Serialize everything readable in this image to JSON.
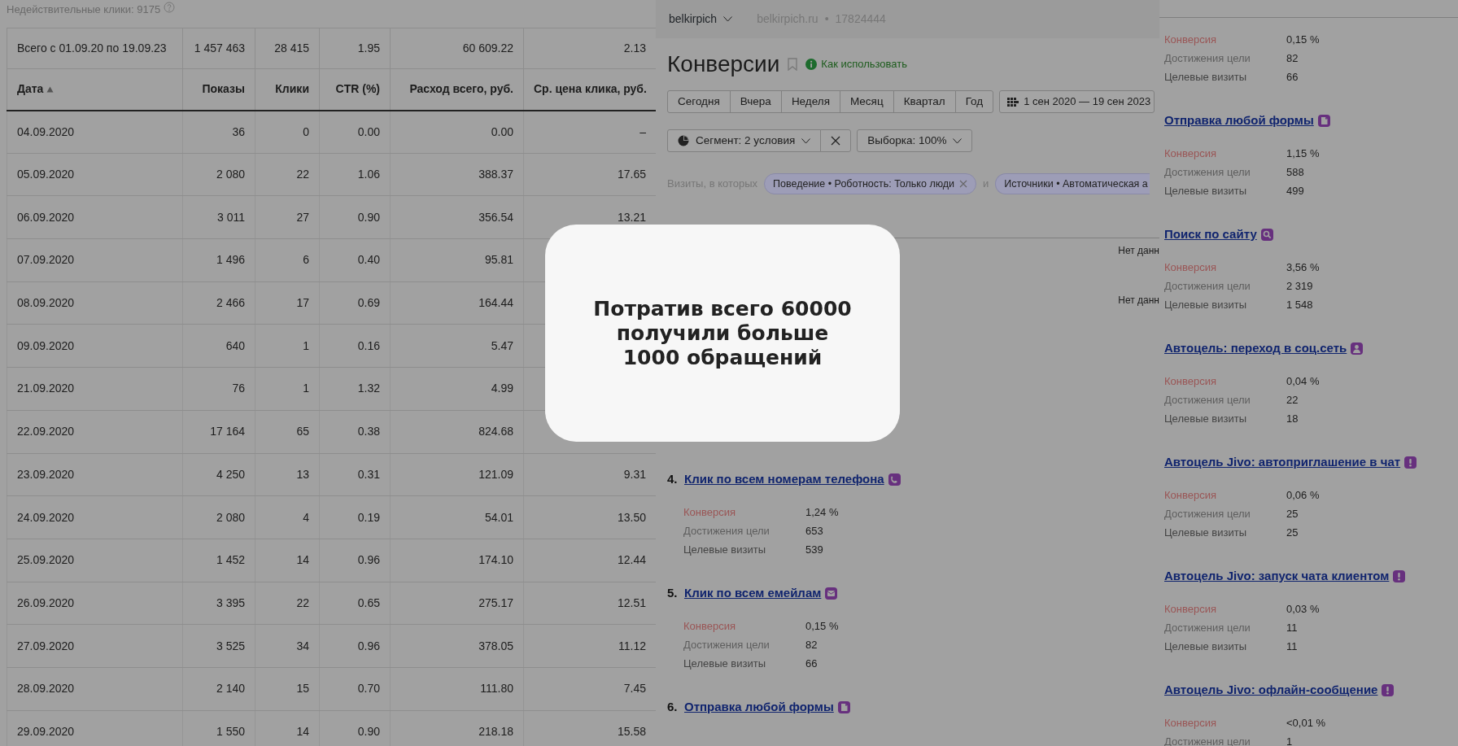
{
  "left_panel": {
    "invalid_clicks": "Недействительные клики: 9175",
    "table": {
      "total_row": [
        "Всего с 01.09.20 по 19.09.23",
        "1 457 463",
        "28 415",
        "1.95",
        "60 609.22",
        "2.13"
      ],
      "columns": [
        {
          "label": "Дата",
          "sorted": true
        },
        {
          "label": "Показы",
          "sorted": false
        },
        {
          "label": "Клики",
          "sorted": false
        },
        {
          "label": "CTR (%)",
          "sorted": false
        },
        {
          "label": "Расход всего, руб.",
          "sorted": false
        },
        {
          "label": "Ср. цена клика, руб.",
          "sorted": false
        }
      ],
      "rows": [
        [
          "04.09.2020",
          "36",
          "0",
          "0.00",
          "0.00",
          "–"
        ],
        [
          "05.09.2020",
          "2 080",
          "22",
          "1.06",
          "388.37",
          "17.65"
        ],
        [
          "06.09.2020",
          "3 011",
          "27",
          "0.90",
          "356.54",
          "13.21"
        ],
        [
          "07.09.2020",
          "1 496",
          "6",
          "0.40",
          "95.81"
        ],
        [
          "08.09.2020",
          "2 466",
          "17",
          "0.69",
          "164.44"
        ],
        [
          "09.09.2020",
          "640",
          "1",
          "0.16",
          "5.47"
        ],
        [
          "21.09.2020",
          "76",
          "1",
          "1.32",
          "4.99"
        ],
        [
          "22.09.2020",
          "17 164",
          "65",
          "0.38",
          "824.68"
        ],
        [
          "23.09.2020",
          "4 250",
          "13",
          "0.31",
          "121.09",
          "9.31"
        ],
        [
          "24.09.2020",
          "2 080",
          "4",
          "0.19",
          "54.01",
          "13.50"
        ],
        [
          "25.09.2020",
          "1 452",
          "14",
          "0.96",
          "174.10",
          "12.44"
        ],
        [
          "26.09.2020",
          "3 395",
          "22",
          "0.65",
          "275.17",
          "12.51"
        ],
        [
          "27.09.2020",
          "3 525",
          "34",
          "0.96",
          "378.05",
          "11.12"
        ],
        [
          "28.09.2020",
          "2 140",
          "15",
          "0.70",
          "111.80",
          "7.45"
        ],
        [
          "29.09.2020",
          "1 550",
          "14",
          "0.90",
          "218.18",
          "15.58"
        ]
      ]
    }
  },
  "middle_panel": {
    "counter": "belkirpich",
    "site": "belkirpich.ru",
    "separator": "•",
    "counter_id": "17824444",
    "title": "Конверсии",
    "help_link": "Как использовать",
    "periods": [
      "Сегодня",
      "Вчера",
      "Неделя",
      "Месяц",
      "Квартал",
      "Год"
    ],
    "date_range": "1 сен 2020 — 19 сен 2023",
    "segment": "Сегмент: 2 условия",
    "sample": "Выборка: 100%",
    "filter_label": "Визиты, в которых",
    "filter_joiner": "и",
    "chips": [
      {
        "label": "Поведение • Роботность: Только люди",
        "removable": true
      },
      {
        "label": "Источники • Автоматическая а",
        "removable": false
      }
    ],
    "partial_rows": [
      {
        "status": "Нет данн"
      },
      {
        "status": "Нет данн"
      }
    ],
    "goals": [
      {
        "number": "4.",
        "title": "Клик по всем номерам телефона",
        "kind": "phone",
        "metrics": [
          {
            "kind": "conversion",
            "label": "Конверсия",
            "value": "1,24 %"
          },
          {
            "kind": "reached",
            "label": "Достижения цели",
            "value": "653"
          },
          {
            "kind": "visits",
            "label": "Целевые визиты",
            "value": "539"
          }
        ]
      },
      {
        "number": "5.",
        "title": "Клик по всем емейлам",
        "kind": "email",
        "metrics": [
          {
            "kind": "conversion",
            "label": "Конверсия",
            "value": "0,15 %"
          },
          {
            "kind": "reached",
            "label": "Достижения цели",
            "value": "82"
          },
          {
            "kind": "visits",
            "label": "Целевые визиты",
            "value": "66"
          }
        ]
      },
      {
        "number": "6.",
        "title": "Отправка любой формы",
        "kind": "form"
      }
    ]
  },
  "right_panel": {
    "goals": [
      {
        "metrics": [
          {
            "kind": "conversion",
            "label": "Конверсия",
            "value": "0,15 %"
          },
          {
            "kind": "reached",
            "label": "Достижения цели",
            "value": "82"
          },
          {
            "kind": "visits",
            "label": "Целевые визиты",
            "value": "66"
          }
        ]
      },
      {
        "title": "Отправка любой формы",
        "kind": "form",
        "metrics": [
          {
            "kind": "conversion",
            "label": "Конверсия",
            "value": "1,15 %"
          },
          {
            "kind": "reached",
            "label": "Достижения цели",
            "value": "588"
          },
          {
            "kind": "visits",
            "label": "Целевые визиты",
            "value": "499"
          }
        ]
      },
      {
        "title": "Поиск по сайту",
        "kind": "search",
        "metrics": [
          {
            "kind": "conversion",
            "label": "Конверсия",
            "value": "3,56 %"
          },
          {
            "kind": "reached",
            "label": "Достижения цели",
            "value": "2 319"
          },
          {
            "kind": "visits",
            "label": "Целевые визиты",
            "value": "1 548"
          }
        ]
      },
      {
        "title": "Автоцель: переход в соц.сеть",
        "kind": "social",
        "metrics": [
          {
            "kind": "conversion",
            "label": "Конверсия",
            "value": "0,04 %"
          },
          {
            "kind": "reached",
            "label": "Достижения цели",
            "value": "22"
          },
          {
            "kind": "visits",
            "label": "Целевые визиты",
            "value": "18"
          }
        ]
      },
      {
        "title": "Автоцель Jivo: автоприглашение в чат",
        "kind": "alert",
        "metrics": [
          {
            "kind": "conversion",
            "label": "Конверсия",
            "value": "0,06 %"
          },
          {
            "kind": "reached",
            "label": "Достижения цели",
            "value": "25"
          },
          {
            "kind": "visits",
            "label": "Целевые визиты",
            "value": "25"
          }
        ]
      },
      {
        "title": "Автоцель Jivo: запуск чата клиентом",
        "kind": "alert",
        "metrics": [
          {
            "kind": "conversion",
            "label": "Конверсия",
            "value": "0,03 %"
          },
          {
            "kind": "reached",
            "label": "Достижения цели",
            "value": "11"
          },
          {
            "kind": "visits",
            "label": "Целевые визиты",
            "value": "11"
          }
        ]
      },
      {
        "title": "Автоцель Jivo: офлайн-сообщение",
        "kind": "alert",
        "metrics": [
          {
            "kind": "conversion",
            "label": "Конверсия",
            "value": "<0,01 %"
          },
          {
            "kind": "reached",
            "label": "Достижения цели",
            "value": "1"
          }
        ]
      }
    ]
  },
  "callout": {
    "lines": [
      "Потратив всего 60000",
      "получили больше",
      "1000 обращений"
    ]
  }
}
